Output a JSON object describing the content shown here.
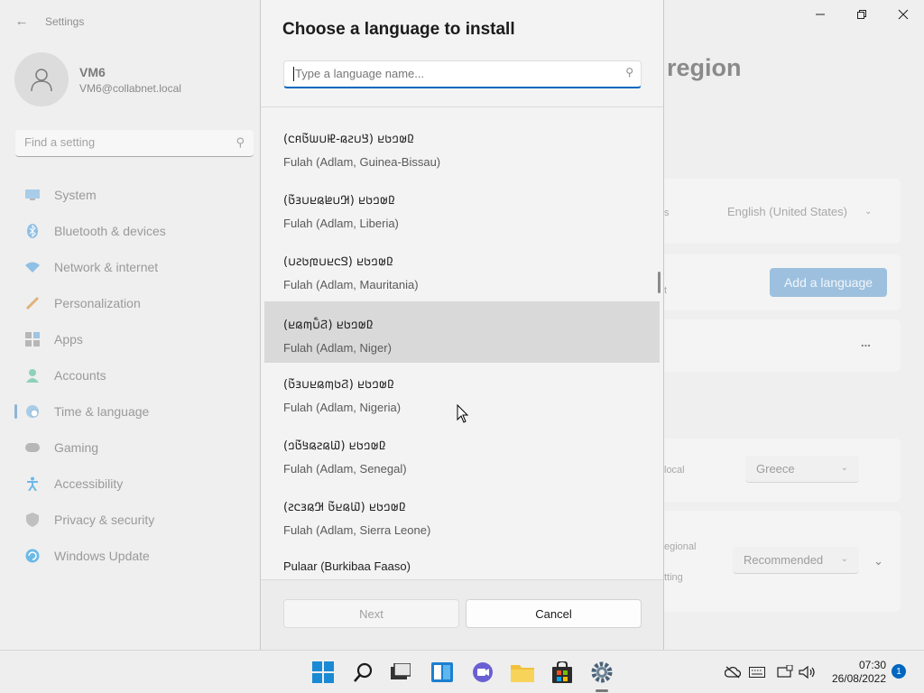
{
  "window": {
    "app_title": "Settings"
  },
  "profile": {
    "name": "VM6",
    "email": "VM6@collabnet.local"
  },
  "settings_search": {
    "placeholder": "Find a setting"
  },
  "nav": {
    "items": [
      {
        "label": "System",
        "icon": "display-icon"
      },
      {
        "label": "Bluetooth & devices",
        "icon": "bluetooth-icon"
      },
      {
        "label": "Network & internet",
        "icon": "wifi-icon"
      },
      {
        "label": "Personalization",
        "icon": "brush-icon"
      },
      {
        "label": "Apps",
        "icon": "apps-icon"
      },
      {
        "label": "Accounts",
        "icon": "person-icon"
      },
      {
        "label": "Time & language",
        "icon": "globe-clock-icon",
        "active": true
      },
      {
        "label": "Gaming",
        "icon": "gamepad-icon"
      },
      {
        "label": "Accessibility",
        "icon": "accessibility-icon"
      },
      {
        "label": "Privacy & security",
        "icon": "shield-icon"
      },
      {
        "label": "Windows Update",
        "icon": "update-icon"
      }
    ]
  },
  "background_page": {
    "title_fragment": "region",
    "display_language_label_fragment": "s",
    "display_language_value": "English (United States)",
    "preferred_label_fragment": "t",
    "add_language_label": "Add a language",
    "more_label": "...",
    "country_label_fragment": "local",
    "country_value": "Greece",
    "regional_label_fragment_1": "egional",
    "regional_label_fragment_2": "tting",
    "regional_format_value": "Recommended"
  },
  "dialog": {
    "title": "Choose a language to install",
    "search_placeholder": "Type a language name...",
    "languages": [
      {
        "native": "(𞤘𞤭𞤲𞤫-𞤄𞤭𞤧𞤢𞥄𞤱𞤮) 𞤆𞤵𞤤𞤢𞤪",
        "english": "Fulah (Adlam, Guinea-Bissau)"
      },
      {
        "native": "(𞤂𞤭𞤦𞤫𞤪𞤭𞤴𞤢𞥄) 𞤆𞤵𞤤𞤢𞤪",
        "english": "Fulah (Adlam, Liberia)"
      },
      {
        "native": "(𞤃𞤮𞤪𞤭𞤼𞤢𞤲𞤭) 𞤆𞤵𞤤𞤢𞤪",
        "english": "Fulah (Adlam, Mauritania)"
      },
      {
        "native": "(𞤐𞤭𞥅𞤶𞤫𞤪) 𞤆𞤵𞤤𞤢𞤪",
        "english": "Fulah (Adlam, Niger)",
        "selected": true
      },
      {
        "native": "(𞤐𞤢𞤶𞤫𞤪𞤭𞤴𞤢𞥄) 𞤆𞤵𞤤𞤢𞤪",
        "english": "Fulah (Adlam, Nigeria)"
      },
      {
        "native": "(𞤅𞤫𞤲𞤫𞤺𞤢𞥄𞤤) 𞤆𞤵𞤤𞤢𞤪",
        "english": "Fulah (Adlam, Senegal)"
      },
      {
        "native": "(𞤅𞤫𞤪𞤢𞥄 𞤂𞤫𞤴𞤮𞤲) 𞤆𞤵𞤤𞤢𞤪",
        "english": "Fulah (Adlam, Sierra Leone)"
      }
    ],
    "last_partial_item": "Pulaar (Burkibaa Faaso)",
    "next_label": "Next",
    "cancel_label": "Cancel"
  },
  "taskbar": {
    "apps": [
      "windows-start-icon",
      "search-icon",
      "task-view-icon",
      "widgets-icon",
      "chat-icon",
      "file-explorer-icon",
      "store-icon",
      "settings-gear-icon"
    ],
    "time": "07:30",
    "date": "26/08/2022",
    "notification_count": "1"
  }
}
